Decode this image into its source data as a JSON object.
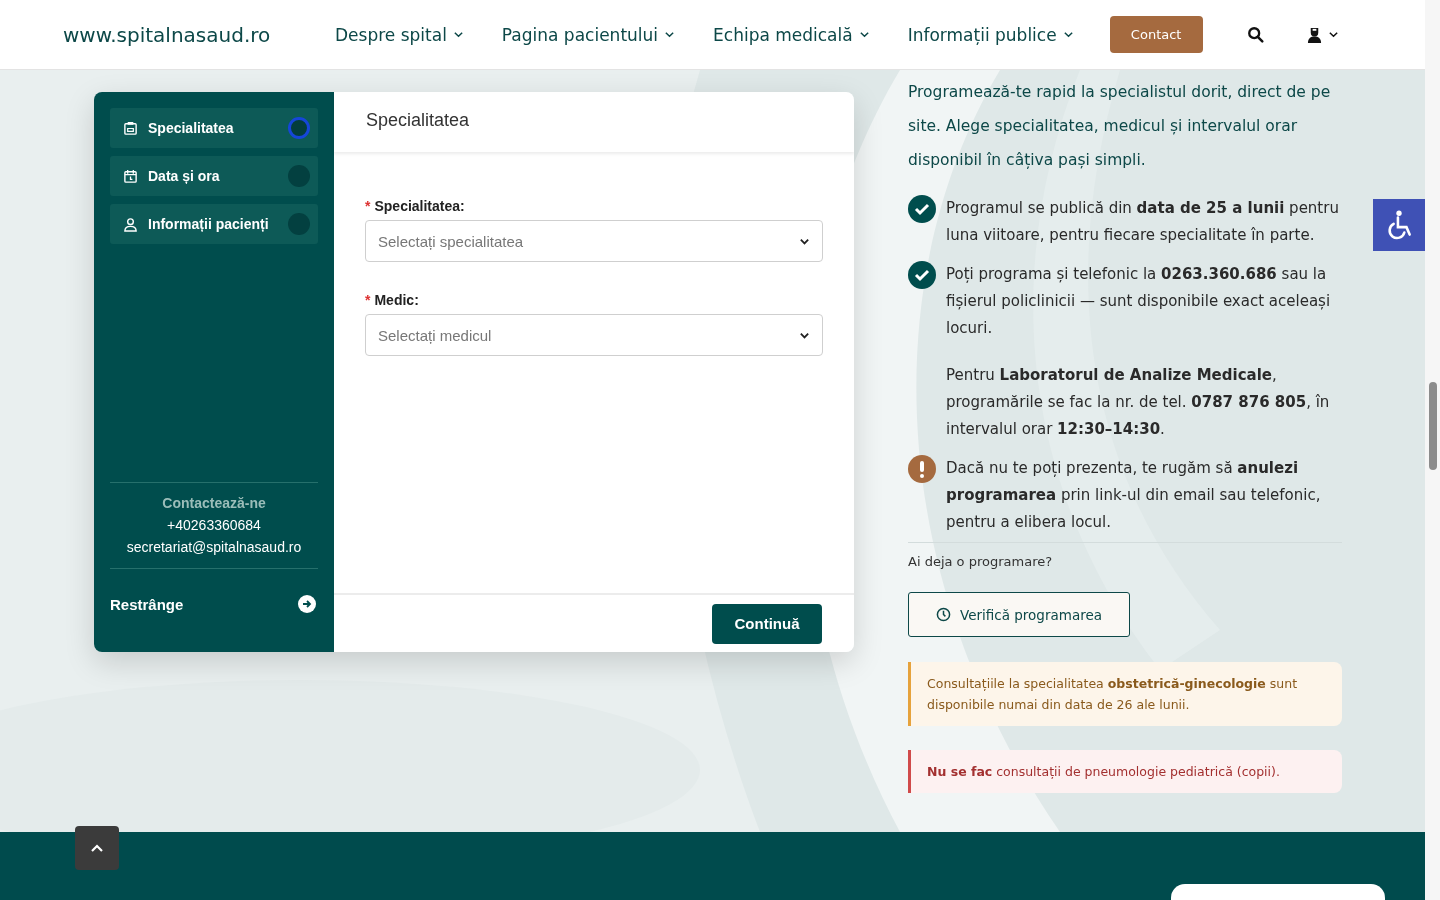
{
  "header": {
    "site": "www.spitalnasaud.ro",
    "nav": [
      {
        "label": "Despre spital"
      },
      {
        "label": "Pagina pacientului"
      },
      {
        "label": "Echipa medicală"
      },
      {
        "label": "Informații publice"
      }
    ],
    "contact_button": "Contact"
  },
  "wizard": {
    "steps": [
      {
        "label": "Specialitatea",
        "kind": "clipboard",
        "selected": true
      },
      {
        "label": "Data și ora",
        "kind": "calendar",
        "selected": false
      },
      {
        "label": "Informații pacienți",
        "kind": "user",
        "selected": false
      }
    ],
    "contact": {
      "heading": "Contactează-ne",
      "phone": "+40263360684",
      "email": "secretariat@spitalnasaud.ro"
    },
    "collapse": "Restrânge",
    "panel_title": "Specialitatea",
    "fields": [
      {
        "required_mark": "*",
        "label": "Specialitatea:",
        "placeholder": "Selectați specialitatea"
      },
      {
        "required_mark": "*",
        "label": "Medic:",
        "placeholder": "Selectați medicul"
      }
    ],
    "continue_button": "Continuă"
  },
  "info": {
    "intro": "Programează-te rapid la specialistul dorit, direct de pe site. Alege specialitatea, medicul și intervalul orar disponibil în câțiva pași simpli.",
    "items": [
      {
        "kind": "check",
        "text": "Programul se publică din **data de 25 a lunii** pentru luna viitoare, pentru fiecare specialitate în parte."
      },
      {
        "kind": "check",
        "text": "Poți programa și telefonic la **0263.360.686** sau la fișierul policlinicii — sunt disponibile exact aceleași locuri."
      },
      {
        "kind": "plain",
        "text": "Pentru **Laboratorul de Analize Medicale**, programările se fac la nr. de tel. **0787 876 805**, în intervalul orar **12:30–14:30**."
      },
      {
        "kind": "alert",
        "text": "Dacă nu te poți prezenta, te rugăm să **anulezi programarea** prin link-ul din email sau telefonic, pentru a elibera locul."
      }
    ],
    "existing_question": "Ai deja o programare?",
    "verify_button": "Verifică programarea",
    "notes": [
      {
        "kind": "warning",
        "text": "Consultațiile la specialitatea **obstetrică-ginecologie** sunt disponibile numai din data de 26 ale lunii."
      },
      {
        "kind": "danger",
        "text": "**Nu se fac** consultații de pneumologie pediatrică (copii)."
      }
    ]
  }
}
